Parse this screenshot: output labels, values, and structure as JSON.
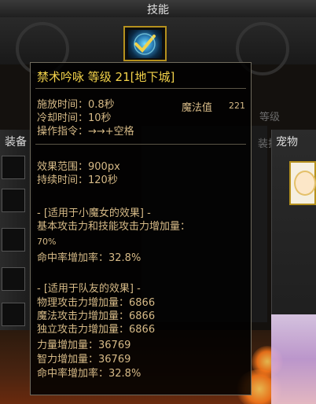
{
  "window": {
    "title": "技能"
  },
  "background": {
    "left_tab": "装备",
    "right_tab": "宠物",
    "ghost_text": [
      "装扮",
      "等级"
    ]
  },
  "tooltip": {
    "title": "禁术吟咏 等级 21[地下城]",
    "cast_time": "施放时间：0.8秒",
    "mp_label": "魔法值",
    "mp_value": "221",
    "cooldown": "冷却时间：10秒",
    "command": "操作指令：→→+空格",
    "effect_range": "效果范围：900px",
    "duration": "持续时间：120秒",
    "self_header": "- [适用于小魔女的效果] -",
    "self_line1": "基本攻击力和技能攻击力增加量：",
    "self_line1_value": "70%",
    "self_line2": "命中率增加率：32.8%",
    "party_header": "- [适用于队友的效果] -",
    "party_lines": [
      "物理攻击力增加量：6866",
      "魔法攻击力增加量：6866",
      "独立攻击力增加量：6866",
      "力量增加量：36769",
      "智力增加量：36769",
      "命中率增加率：32.8%"
    ]
  },
  "colors": {
    "title": "#f2d24a",
    "body_text": "#d6ba87",
    "slot_border": "#b5911e"
  }
}
